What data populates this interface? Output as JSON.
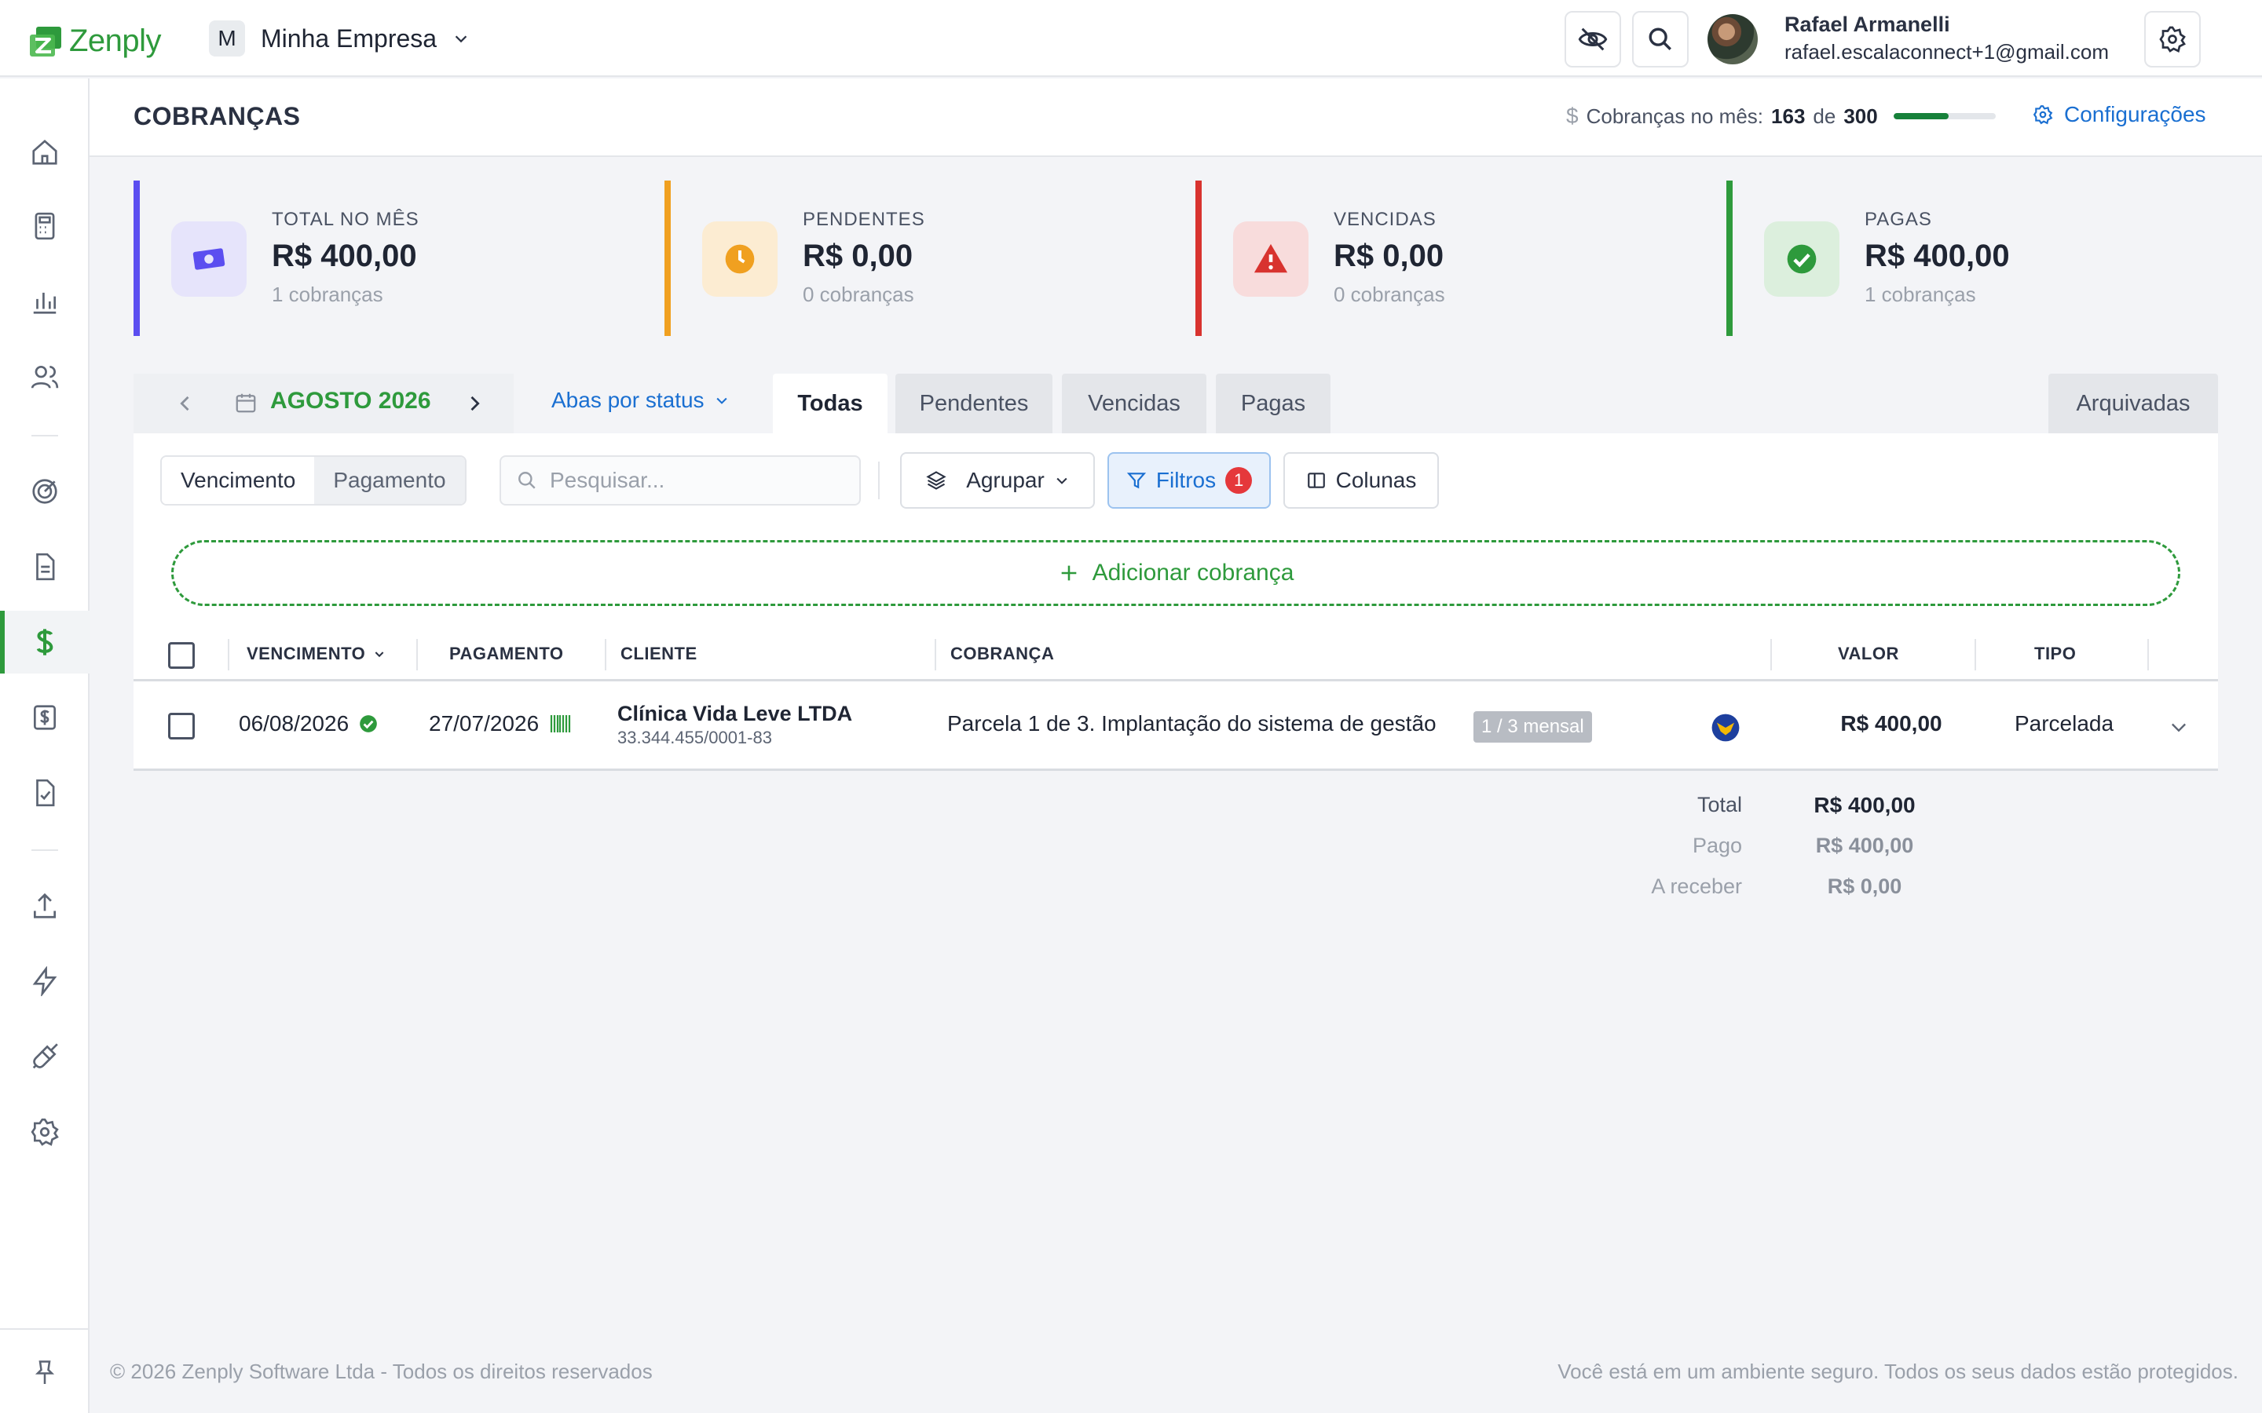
{
  "app": {
    "name": "Zenply",
    "brand_color": "#2e9a3c"
  },
  "company": {
    "initial": "M",
    "name": "Minha Empresa"
  },
  "user": {
    "name": "Rafael Armanelli",
    "email": "rafael.escalaconnect+1@gmail.com"
  },
  "icons": {
    "topbar": [
      "eye-off-icon",
      "search-icon",
      "gear-icon"
    ],
    "sidebar": [
      "home-icon",
      "calculator-icon",
      "bar-chart-icon",
      "users-icon",
      "target-icon",
      "document-icon",
      "dollar-icon",
      "invoice-icon",
      "checklist-icon",
      "upload-icon",
      "lightning-icon",
      "plug-icon",
      "gear-icon",
      "pin-icon"
    ]
  },
  "page": {
    "title": "COBRANÇAS",
    "quota": {
      "label": "Cobranças no mês:",
      "used": "163",
      "of": "de",
      "total": "300",
      "fraction": 0.5433
    },
    "config_label": "Configurações"
  },
  "cards": [
    {
      "label": "TOTAL NO MÊS",
      "value": "R$ 400,00",
      "sub": "1 cobranças",
      "color": "#5b4ef0",
      "icon": "money-icon"
    },
    {
      "label": "PENDENTES",
      "value": "R$ 0,00",
      "sub": "0 cobranças",
      "color": "#f0a020",
      "icon": "clock-icon"
    },
    {
      "label": "VENCIDAS",
      "value": "R$ 0,00",
      "sub": "0 cobranças",
      "color": "#d8332f",
      "icon": "alert-icon"
    },
    {
      "label": "PAGAS",
      "value": "R$ 400,00",
      "sub": "1 cobranças",
      "color": "#2e9a3c",
      "icon": "check-circle-icon"
    }
  ],
  "month_nav": {
    "label": "AGOSTO 2026"
  },
  "status_dropdown": {
    "label": "Abas por status"
  },
  "tabs": [
    {
      "label": "Todas",
      "active": true
    },
    {
      "label": "Pendentes",
      "active": false
    },
    {
      "label": "Vencidas",
      "active": false
    },
    {
      "label": "Pagas",
      "active": false
    },
    {
      "label": "Arquivadas",
      "active": false
    }
  ],
  "toolbar": {
    "date_mode": [
      "Vencimento",
      "Pagamento"
    ],
    "search_placeholder": "Pesquisar...",
    "group_label": "Agrupar",
    "filter_label": "Filtros",
    "filter_count": "1",
    "columns_label": "Colunas",
    "add_label": "Adicionar cobrança"
  },
  "table": {
    "columns": [
      "VENCIMENTO",
      "PAGAMENTO",
      "CLIENTE",
      "COBRANÇA",
      "VALOR",
      "TIPO"
    ],
    "rows": [
      {
        "due_date": "06/08/2026",
        "payment_date": "27/07/2026",
        "client_name": "Clínica Vida Leve LTDA",
        "client_doc": "33.344.455/0001-83",
        "description": "Parcela 1 de 3. Implantação do sistema de gestão",
        "badge": "1 / 3 mensal",
        "value": "R$ 400,00",
        "type": "Parcelada"
      }
    ]
  },
  "totals": [
    {
      "label": "Total",
      "value": "R$ 400,00"
    },
    {
      "label": "Pago",
      "value": "R$ 400,00"
    },
    {
      "label": "A receber",
      "value": "R$ 0,00"
    }
  ],
  "footer": {
    "left": "© 2026 Zenply Software Ltda - Todos os direitos reservados",
    "right": "Você está em um ambiente seguro. Todos os seus dados estão protegidos."
  }
}
